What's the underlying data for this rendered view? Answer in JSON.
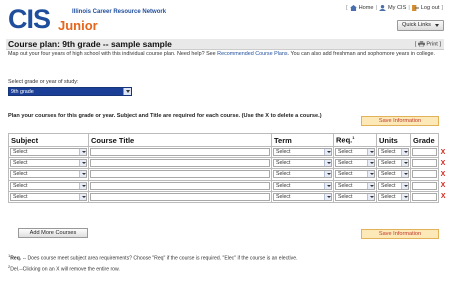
{
  "header": {
    "logo_cis": "CIS",
    "logo_junior": "Junior",
    "network_name": "Illinois Career Resource Network",
    "links": [
      {
        "label": "Home",
        "icon": "home-icon"
      },
      {
        "label": "My CIS",
        "icon": "user-icon"
      },
      {
        "label": "Log out",
        "icon": "logout-icon"
      }
    ],
    "quick_links_label": "Quick Links"
  },
  "page": {
    "title": "Course plan: 9th grade -- sample sample",
    "print_label": "Print",
    "intro_before": "Map out your four years of high school with this individual course plan. Need help? See ",
    "intro_link": "Recommended Course Plans",
    "intro_after": ". You can also add freshman and sophomore years in college.",
    "select_label": "Select grade or year of study:",
    "selected_grade": "9th grade",
    "plan_instructions": "Plan your courses for this grade or year. Subject and Title are required for each course. (Use the X to delete a course.)",
    "save_label": "Save Information",
    "add_more_label": "Add More Courses"
  },
  "table": {
    "columns": [
      "Subject",
      "Course Title",
      "Term",
      "Req.",
      "Units",
      "Grade"
    ],
    "req_superscript": "1",
    "rows": [
      {
        "subject": "Select",
        "title": "",
        "term": "Select",
        "req": "Select",
        "units": "Select",
        "grade": "",
        "delete": "X"
      },
      {
        "subject": "Select",
        "title": "",
        "term": "Select",
        "req": "Select",
        "units": "Select",
        "grade": "",
        "delete": "X"
      },
      {
        "subject": "Select",
        "title": "",
        "term": "Select",
        "req": "Select",
        "units": "Select",
        "grade": "",
        "delete": "X"
      },
      {
        "subject": "Select",
        "title": "",
        "term": "Select",
        "req": "Select",
        "units": "Select",
        "grade": "",
        "delete": "X"
      },
      {
        "subject": "Select",
        "title": "",
        "term": "Select",
        "req": "Select",
        "units": "Select",
        "grade": "",
        "delete": "X"
      }
    ]
  },
  "notes": {
    "req_sup": "1",
    "req_label": "Req.",
    "req_text": " -- Does course meet subject area requirements? Choose \"Req\" if the course is required. \"Elec\" if the course is an elective.",
    "del_sup": "2",
    "del_text": "Del.--Clicking on an X will remove the entire row."
  },
  "colors": {
    "brand_blue": "#1f4e9c",
    "brand_orange": "#e5661c",
    "delete_red": "#d0261d"
  }
}
